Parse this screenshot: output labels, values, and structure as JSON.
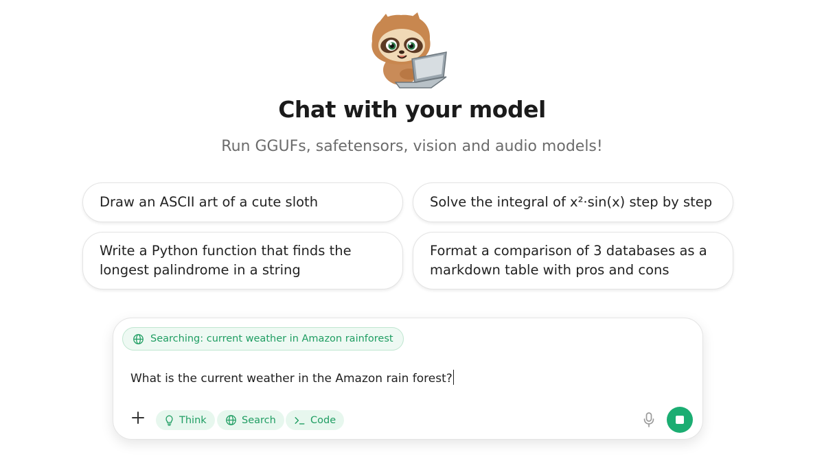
{
  "header": {
    "title": "Chat with your model",
    "subtitle": "Run GGUFs, safetensors, vision and audio models!",
    "mascot": "sloth-with-laptop"
  },
  "suggestions": [
    {
      "text": "Draw an ASCII art of a cute sloth"
    },
    {
      "text": "Solve the integral of x²·sin(x) step by step"
    },
    {
      "text": "Write a Python function that finds the longest palindrome in a string"
    },
    {
      "text": "Format a comparison of 3 databases as a markdown table with pros and cons"
    }
  ],
  "composer": {
    "status_chip": "Searching: current weather in Amazon rainforest",
    "input_value": "What is the current weather in the Amazon rain forest?",
    "tools": [
      {
        "label": "Think",
        "icon": "lightbulb-icon"
      },
      {
        "label": "Search",
        "icon": "globe-icon"
      },
      {
        "label": "Code",
        "icon": "terminal-icon"
      }
    ],
    "add_icon": "plus-icon",
    "mic_icon": "microphone-icon",
    "stop_icon": "stop-icon"
  },
  "colors": {
    "accent": "#1bad72",
    "accent_text": "#1f9d62",
    "chip_bg": "#e7f7ee",
    "subtitle": "#6b6b6b"
  }
}
